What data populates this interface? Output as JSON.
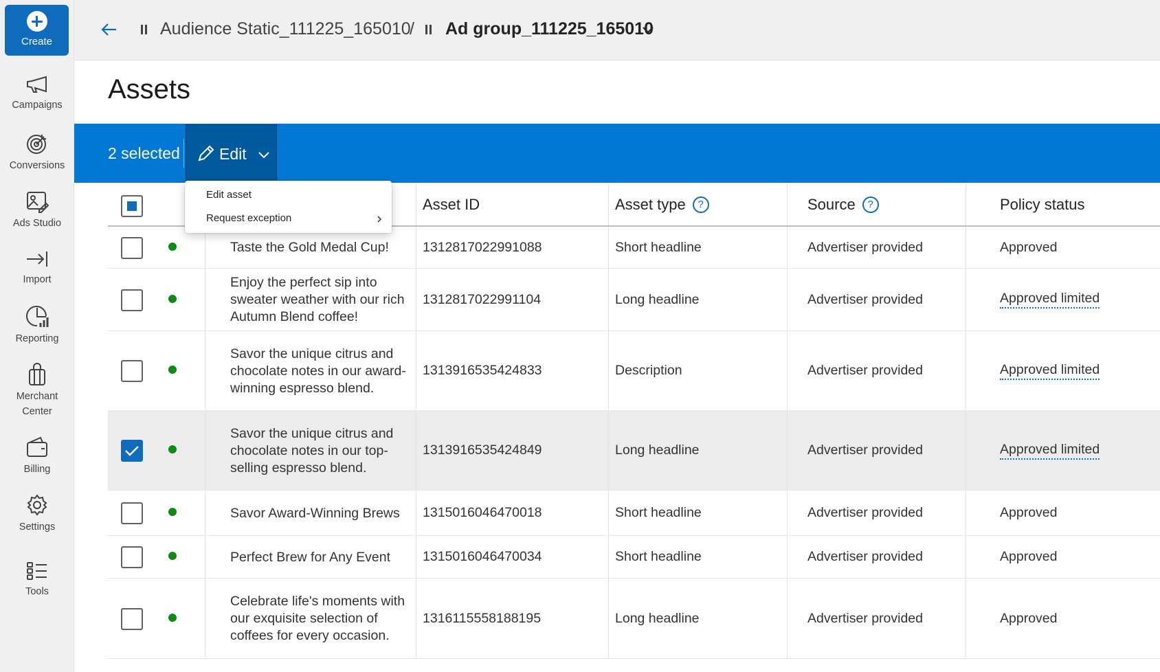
{
  "sidebar": {
    "create_label": "Create",
    "items": [
      {
        "label": "Campaigns",
        "icon": "megaphone-icon"
      },
      {
        "label": "Conversions",
        "icon": "target-icon"
      },
      {
        "label": "Ads Studio",
        "icon": "image-edit-icon"
      },
      {
        "label": "Import",
        "icon": "import-arrow-icon"
      },
      {
        "label": "Reporting",
        "icon": "report-chart-icon"
      },
      {
        "label": "Merchant",
        "label2": "Center",
        "icon": "shopping-bag-icon"
      },
      {
        "label": "Billing",
        "icon": "wallet-icon"
      },
      {
        "label": "Settings",
        "icon": "gear-icon"
      },
      {
        "label": "Tools",
        "icon": "tools-list-icon"
      }
    ]
  },
  "breadcrumb": {
    "parent": "Audience Static_111225_165010",
    "separator": "/",
    "current": "Ad group_111225_165010"
  },
  "page": {
    "title": "Assets"
  },
  "selection_bar": {
    "count_label": "2 selected",
    "edit_label": "Edit"
  },
  "edit_menu": {
    "items": [
      "Edit asset",
      "Request exception"
    ]
  },
  "table": {
    "headers": {
      "asset_id": "Asset ID",
      "asset_type": "Asset type",
      "source": "Source",
      "policy_status": "Policy status"
    },
    "rows": [
      {
        "text": "Taste the Gold Medal Cup!",
        "asset_id": "1312817022991088",
        "asset_type": "Short headline",
        "source": "Advertiser provided",
        "policy_status": "Approved",
        "checked": false
      },
      {
        "text": "Enjoy the perfect sip into sweater weather with our rich Autumn Blend coffee!",
        "asset_id": "1312817022991104",
        "asset_type": "Long headline",
        "source": "Advertiser provided",
        "policy_status": "Approved limited",
        "checked": false
      },
      {
        "text": "Savor the unique citrus and chocolate notes in our award-winning espresso blend.",
        "asset_id": "1313916535424833",
        "asset_type": "Description",
        "source": "Advertiser provided",
        "policy_status": "Approved limited",
        "checked": false
      },
      {
        "text": "Savor the unique citrus and chocolate notes in our top-selling espresso blend.",
        "asset_id": "1313916535424849",
        "asset_type": "Long headline",
        "source": "Advertiser provided",
        "policy_status": "Approved limited",
        "checked": true
      },
      {
        "text": "Savor Award-Winning Brews",
        "asset_id": "1315016046470018",
        "asset_type": "Short headline",
        "source": "Advertiser provided",
        "policy_status": "Approved",
        "checked": false
      },
      {
        "text": "Perfect Brew for Any Event",
        "asset_id": "1315016046470034",
        "asset_type": "Short headline",
        "source": "Advertiser provided",
        "policy_status": "Approved",
        "checked": false
      },
      {
        "text": "Celebrate life's moments with our exquisite selection of coffees for every occasion.",
        "asset_id": "1316115558188195",
        "asset_type": "Long headline",
        "source": "Advertiser provided",
        "policy_status": "Approved",
        "checked": false
      }
    ]
  },
  "colors": {
    "accent": "#0078d4",
    "edit_button": "#005a9e",
    "status_dot": "#0e8a16"
  }
}
